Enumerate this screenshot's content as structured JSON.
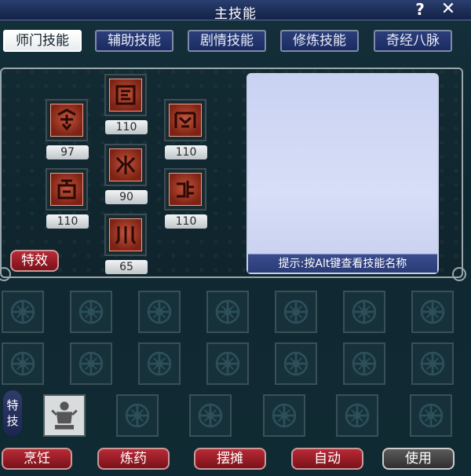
{
  "window": {
    "title": "主技能"
  },
  "titlebar": {
    "help_glyph": "?",
    "close_glyph": "✕"
  },
  "tabs": [
    {
      "label": "师门技能",
      "active": true
    },
    {
      "label": "辅助技能",
      "active": false
    },
    {
      "label": "剧情技能",
      "active": false
    },
    {
      "label": "修炼技能",
      "active": false
    },
    {
      "label": "奇经八脉",
      "active": false
    }
  ],
  "skills": [
    {
      "icon": "sect-skill-rune-1-icon",
      "level": "97"
    },
    {
      "icon": "sect-skill-rune-2-icon",
      "level": "110"
    },
    {
      "icon": "sect-skill-rune-3-icon",
      "level": "110"
    },
    {
      "icon": "sect-skill-rune-4-icon",
      "level": "110"
    },
    {
      "icon": "sect-skill-rune-5-icon",
      "level": "90"
    },
    {
      "icon": "sect-skill-rune-6-icon",
      "level": "110"
    },
    {
      "icon": "sect-skill-rune-7-icon",
      "level": "65"
    }
  ],
  "info_hint": "提示:按Alt键查看技能名称",
  "effects_button": "特效",
  "special_label": "特技",
  "bottom_buttons": {
    "cook": "烹饪",
    "alchemy": "炼药",
    "stall": "摆摊",
    "auto": "自动",
    "use": "使用"
  },
  "colors": {
    "accent_red": "#9c1c24",
    "tab_blue": "#22336e",
    "panel_bg": "#12282f"
  }
}
